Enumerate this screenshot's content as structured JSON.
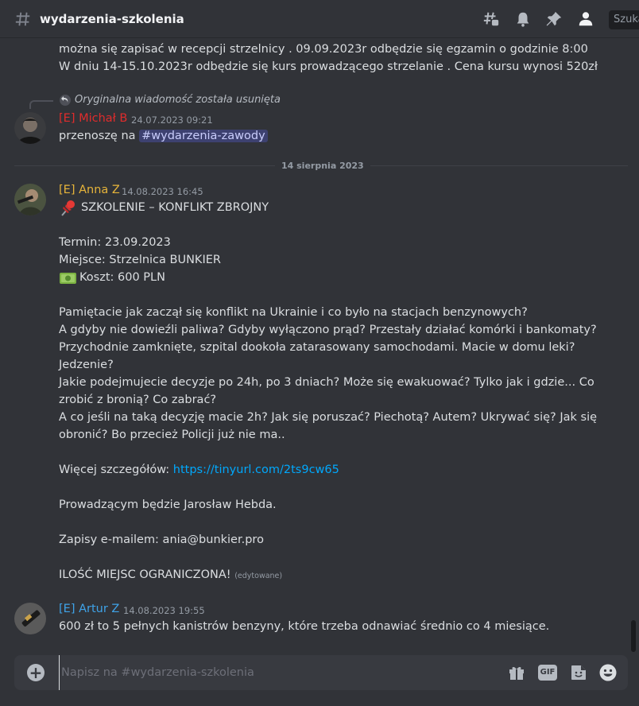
{
  "header": {
    "channel_name": "wydarzenia-szkolenia",
    "search_placeholder": "Szukaj",
    "icons": [
      "threads-icon",
      "bell-icon",
      "pin-icon",
      "members-icon"
    ]
  },
  "top_message": {
    "line1": "można się zapisać w recepcji strzelnicy . 09.09.2023r  odbędzie się egzamin o godzinie 8:00",
    "line2": "W dniu 14-15.10.2023r odbędzie się kurs prowadzącego strzelanie . Cena kursu wynosi 520zł"
  },
  "message_michal": {
    "reply_text": "Oryginalna wiadomość została usunięta",
    "author": "[E] Michał B",
    "timestamp": "24.07.2023 09:21",
    "text_prefix": "przenoszę na ",
    "channel_mention": "#wydarzenia-zawody",
    "author_color": "#e02c2c"
  },
  "date_divider": "14 sierpnia 2023",
  "message_anna": {
    "author": "[E] Anna Z",
    "timestamp": "14.08.2023 16:45",
    "author_color": "#e6b43a",
    "lines": {
      "l1": "SZKOLENIE – KONFLIKT ZBROJNY",
      "l2": "Termin: 23.09.2023",
      "l3": "Miejsce: Strzelnica BUNKIER",
      "l4": "Koszt: 600 PLN",
      "l5": "Pamiętacie jak zaczął się konflikt na Ukrainie i co było na stacjach benzynowych?",
      "l6": "A gdyby nie dowieźli paliwa? Gdyby wyłączono prąd? Przestały działać komórki i bankomaty?",
      "l7": "Przychodnie zamknięte, szpital dookoła zatarasowany samochodami. Macie w domu leki?",
      "l8": "Jedzenie?",
      "l9": "Jakie podejmujecie decyzje po 24h, po 3 dniach? Może się ewakuować? Tylko jak i gdzie... Co",
      "l10": "zrobić z bronią? Co zabrać?",
      "l11": "A co jeśli na taką decyzję macie 2h? Jak się poruszać? Piechotą? Autem? Ukrywać się? Jak się",
      "l12": "obronić? Bo przecież Policji już nie ma..",
      "l13_prefix": "Więcej szczegółów: ",
      "l13_link": "https://tinyurl.com/2ts9cw65",
      "l14": "Prowadzącym będzie Jarosław Hebda.",
      "l15": "Zapisy e-mailem: ania@bunkier.pro",
      "l16": "ILOŚĆ MIEJSC OGRANICZONA!",
      "edited": "(edytowane)"
    }
  },
  "message_artur": {
    "author": "[E] Artur Z",
    "timestamp": "14.08.2023 19:55",
    "author_color": "#3fa3e8",
    "text": "600 zł to 5 pełnych kanistrów benzyny, które trzeba odnawiać średnio co 4 miesiące."
  },
  "composer": {
    "placeholder": "Napisz na #wydarzenia-szkolenia",
    "gif_label": "GIF"
  }
}
